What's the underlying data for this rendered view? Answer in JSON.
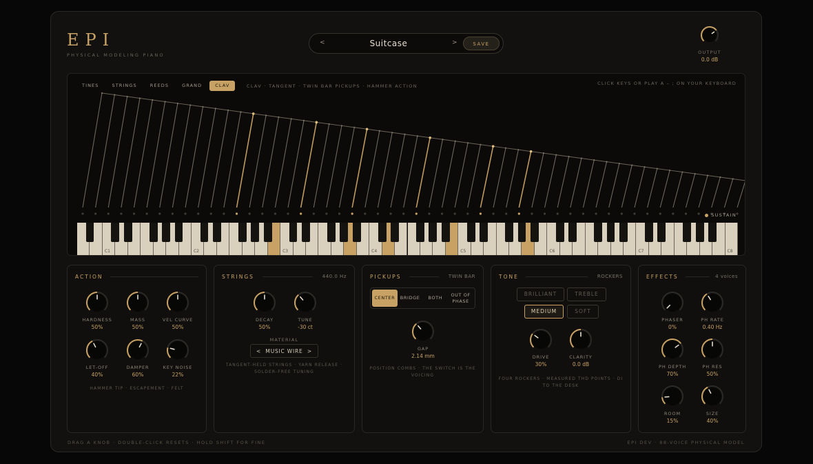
{
  "brand": {
    "logo": "EPI",
    "subtitle": "PHYSICAL MODELING PIANO"
  },
  "preset": {
    "prev": "<",
    "next": ">",
    "name": "Suitcase",
    "save_label": "SAVE"
  },
  "output": {
    "label": "OUTPUT",
    "value": "0.0 dB",
    "level": 0.7
  },
  "modes": {
    "items": [
      {
        "label": "TINES",
        "active": false
      },
      {
        "label": "STRINGS",
        "active": false
      },
      {
        "label": "REEDS",
        "active": false
      },
      {
        "label": "GRAND",
        "active": false
      },
      {
        "label": "CLAV",
        "active": true
      }
    ],
    "description": "CLAV · TANGENT · TWIN BAR PICKUPS · HAMMER ACTION",
    "hint": "CLICK KEYS OR PLAY A – ; ON YOUR KEYBOARD",
    "sustain_label": "SUSTAIN"
  },
  "keyboard": {
    "octave_labels": [
      "C1",
      "C2",
      "C3",
      "C4",
      "C5",
      "C6",
      "C7",
      "C8"
    ],
    "lit_white": [
      15,
      21,
      24,
      29,
      35
    ]
  },
  "action": {
    "title": "ACTION",
    "knobs": [
      {
        "label": "HARDNESS",
        "value": "50%",
        "level": 0.5
      },
      {
        "label": "MASS",
        "value": "50%",
        "level": 0.5
      },
      {
        "label": "VEL CURVE",
        "value": "50%",
        "level": 0.5
      },
      {
        "label": "LET-OFF",
        "value": "40%",
        "level": 0.4
      },
      {
        "label": "DAMPER",
        "value": "60%",
        "level": 0.6
      },
      {
        "label": "KEY NOISE",
        "value": "22%",
        "level": 0.22
      }
    ],
    "note": "HAMMER TIP · ESCAPEMENT · FELT"
  },
  "strings": {
    "title": "STRINGS",
    "side": "440.0 Hz",
    "knobs": [
      {
        "label": "DECAY",
        "value": "50%",
        "level": 0.5
      },
      {
        "label": "TUNE",
        "value": "-30 ct",
        "level": 0.35
      }
    ],
    "material_label": "MATERIAL",
    "material": {
      "prev": "<",
      "value": "MUSIC WIRE",
      "next": ">"
    },
    "note": "TANGENT-HELD STRINGS · YARN RELEASE · SOLDER-FREE TUNING"
  },
  "pickups": {
    "title": "PICKUPS",
    "side": "TWIN BAR",
    "modes": [
      {
        "label": "CENTER",
        "active": true
      },
      {
        "label": "BRIDGE",
        "active": false
      },
      {
        "label": "BOTH",
        "active": false
      },
      {
        "label": "OUT OF PHASE",
        "active": false
      }
    ],
    "knob": {
      "label": "GAP",
      "value": "2.14 mm",
      "level": 0.35
    },
    "note": "POSITION COMBS · THE SWITCH IS THE VOICING"
  },
  "tone": {
    "title": "TONE",
    "side": "ROCKERS",
    "rockers": [
      {
        "label": "BRILLIANT",
        "active": false
      },
      {
        "label": "TREBLE",
        "active": false
      },
      {
        "label": "MEDIUM",
        "active": true
      },
      {
        "label": "SOFT",
        "active": false
      }
    ],
    "knobs": [
      {
        "label": "DRIVE",
        "value": "30%",
        "level": 0.3
      },
      {
        "label": "CLARITY",
        "value": "0.0 dB",
        "level": 0.5
      }
    ],
    "note": "FOUR ROCKERS · MEASURED THD POINTS · DI TO THE DESK"
  },
  "effects": {
    "title": "EFFECTS",
    "side": "4 voices",
    "knobs": [
      {
        "label": "PHASER",
        "value": "0%",
        "level": 0.0
      },
      {
        "label": "PH RATE",
        "value": "0.40 Hz",
        "level": 0.38
      },
      {
        "label": "PH DEPTH",
        "value": "70%",
        "level": 0.7
      },
      {
        "label": "PH RES",
        "value": "50%",
        "level": 0.5
      },
      {
        "label": "ROOM",
        "value": "15%",
        "level": 0.15
      },
      {
        "label": "SIZE",
        "value": "40%",
        "level": 0.4
      }
    ]
  },
  "footer": {
    "left": "DRAG A KNOB · DOUBLE-CLICK RESETS · HOLD SHIFT FOR FINE",
    "right": "EPI DEV · 88-VOICE PHYSICAL MODEL"
  },
  "colors": {
    "accent": "#c8a264",
    "background": "#121110",
    "key_white": "#d9d0bd"
  }
}
